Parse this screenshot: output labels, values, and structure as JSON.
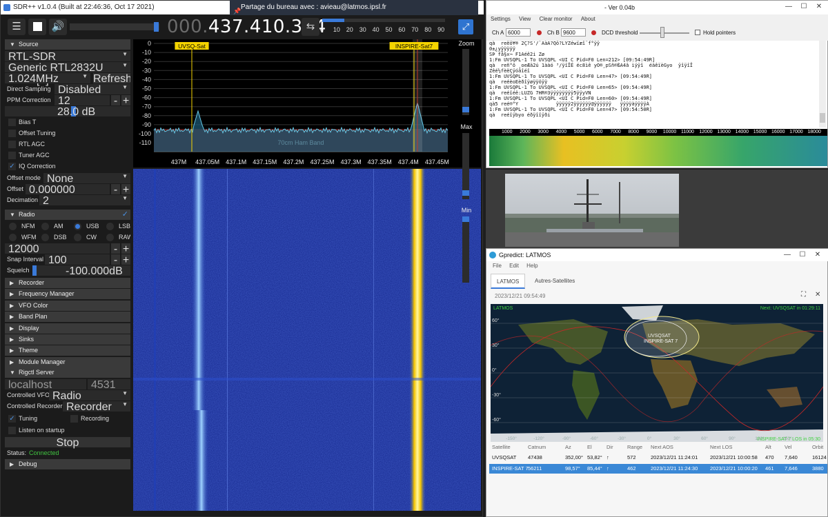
{
  "sdr": {
    "title": "SDR++ v1.0.4 (Built at 22:46:36, Oct 17 2021)",
    "frequency_dim": "000.",
    "frequency_main": "437.410.304",
    "snr_ticks": [
      "0",
      "10",
      "20",
      "30",
      "40",
      "50",
      "60",
      "70",
      "80",
      "90"
    ],
    "snr_level_percent": 18,
    "sidebar": {
      "source": {
        "header": "Source",
        "device": "RTL-SDR",
        "tuner": "Generic RTL2832U OEM [0]",
        "samplerate": "1.024MHz",
        "refresh": "Refresh",
        "direct_sampling_label": "Direct Sampling",
        "direct_sampling_value": "Disabled",
        "ppm_label": "PPM Correction",
        "ppm_value": "12",
        "gain": "28.0 dB",
        "bias_t": "Bias T",
        "offset_tuning": "Offset Tuning",
        "rtl_agc": "RTL AGC",
        "tuner_agc": "Tuner AGC",
        "iq_correction": "IQ Correction",
        "offset_mode_label": "Offset mode",
        "offset_mode_value": "None",
        "offset_label": "Offset",
        "offset_value": "0.000000",
        "decimation_label": "Decimation",
        "decimation_value": "2"
      },
      "radio": {
        "header": "Radio",
        "modes": [
          "NFM",
          "AM",
          "USB",
          "LSB",
          "WFM",
          "DSB",
          "CW",
          "RAW"
        ],
        "selected_mode": "USB",
        "bandwidth": "12000",
        "snap_label": "Snap Interval",
        "snap_value": "100",
        "squelch_label": "Squelch",
        "squelch_value": "-100.000dB"
      },
      "collapsed": [
        "Recorder",
        "Frequency Manager",
        "VFO Color",
        "Band Plan",
        "Display",
        "Sinks",
        "Theme",
        "Module Manager"
      ],
      "rigctl": {
        "header": "Rigctl Server",
        "host": "localhost",
        "port": "4531",
        "vfo_label": "Controlled VFO",
        "vfo_value": "Radio",
        "rec_label": "Controlled Recorder",
        "rec_value": "Recorder",
        "tuning": "Tuning",
        "recording": "Recording",
        "listen": "Listen on startup",
        "stop": "Stop",
        "status_label": "Status:",
        "status_value": "Connected"
      },
      "debug": "Debug"
    },
    "fft": {
      "y_ticks": [
        "0",
        "-10",
        "-20",
        "-30",
        "-40",
        "-50",
        "-60",
        "-70",
        "-80",
        "-90",
        "-100",
        "-110"
      ],
      "x_ticks": [
        "437M",
        "437.05M",
        "437.1M",
        "437.15M",
        "437.2M",
        "437.25M",
        "437.3M",
        "437.35M",
        "437.4M",
        "437.45M"
      ],
      "band_label": "70cm Ham Band",
      "marker1": "UVSQ-Sat",
      "marker2": "INSPIRE-Sat7"
    },
    "zoom_label": "Zoom",
    "max_label": "Max",
    "min_label": "Min"
  },
  "share_bar": "Partage du bureau avec : avieau@latmos.ipsl.fr",
  "decoder": {
    "title": "- Ver 0.04b",
    "menu": [
      "Settings",
      "View",
      "Clear monitor",
      "About"
    ],
    "cha_label": "Ch A",
    "cha_value": "6000",
    "chb_label": "Ch B",
    "chb_value": "9600",
    "dcd_label": "DCD threshold",
    "hold_label": "Hold pointers",
    "log": [
      "qà  reëö¥® 2Ç?S'/`ÃàA?Qö?LYZéwïæî¨f°ÿÿ",
      "0­±¿yÿÿÿÿÿ",
      "SÞ få§x¬ F1Aéê2i Zø",
      "1:Fm UVSQPL-1 To UVSQPL <UI C Pid=F0 Len=212> [09:54:49R]",
      "qà  reñ°ô ¸oeÆä2ú 1ààó ³/ÿîÎÉ éc8ìê yO®¸pSñ®ßA4â ìÿÿî  éäêïèGyo  ÿîÿîÎ",
      "Zêé½fèëÇÿóâîéî",
      "1:Fm UVSQPL-1 To UVSQPL <UI C Pid=F0 Len=47> [09:54:49R]",
      "qà  reéèoEèðîÿøÿÿöÿÿ",
      "1:Fm UVSQPL-1 To UVSQPL <UI C Pid=F0 Len=65> [09:54:49R]",
      "qà  reéîéë:LUZG 7HR®3ÿÿÿÿÿÿÿÿ5ÿÿyVN",
      "1:Fm UVSQPL-1 To UVSQPL <UI C Pid=F0 Len=60> [09:54:49R]",
      "qà5 reé®°Y             ÿÿÿÿÿ2ÿÿÿÿÿÿ@ÿÿÿÿÿÿ   ÿÿÿÿàÿÿÿÿÀ",
      "1:Fm UVSQPL-1 To UVSQPL <UI C Pid=F0 Len=47> [09:54:50R]",
      "qà  reéîÿbyo éðÿîîÿði"
    ],
    "ruler": [
      "1000",
      "2000",
      "3000",
      "4000",
      "5000",
      "6000",
      "7000",
      "8000",
      "9000",
      "10000",
      "11000",
      "12000",
      "13000",
      "14000",
      "15000",
      "16000",
      "17000",
      "18000"
    ]
  },
  "gpredict": {
    "title": "Gpredict: LATMOS",
    "menu": [
      "File",
      "Edit",
      "Help"
    ],
    "tabs": [
      "LATMOS",
      "Autres-Satellites"
    ],
    "datetime": "2023/12/21 09:54:49",
    "map_module": "LATMOS",
    "next_event": "Next: UVSQSAT in 01:29:11",
    "map_sat_label1": "UVSQSAT",
    "map_sat_label2": "INSPIRE-SAT 7",
    "map_bottom_event": "INSPIRE-SAT 7 LOS in 05:30",
    "lat_labels": [
      "60°",
      "30°",
      "0°",
      "-30°",
      "-60°"
    ],
    "lon_labels": [
      "-150°",
      "-120°",
      "-90°",
      "-60°",
      "-30°",
      "0°",
      "30°",
      "60°",
      "90°",
      "120°",
      "150°"
    ],
    "columns": [
      "Satellite",
      "Catnum",
      "Az",
      "El",
      "Dir",
      "Range",
      "Next AOS",
      "Next LOS",
      "Alt",
      "Vel",
      "Orbit"
    ],
    "rows": [
      [
        "UVSQSAT",
        "47438",
        "352,00°",
        "53,82°",
        "↑",
        "572",
        "2023/12/21 11:24:01",
        "2023/12/21 10:00:58",
        "470",
        "7,640",
        "16124"
      ],
      [
        "INSPIRE-SAT 7",
        "56211",
        "98,57°",
        "85,44°",
        "↑",
        "462",
        "2023/12/21 11:24:30",
        "2023/12/21 10:00:20",
        "461",
        "7,646",
        "3880"
      ]
    ]
  }
}
